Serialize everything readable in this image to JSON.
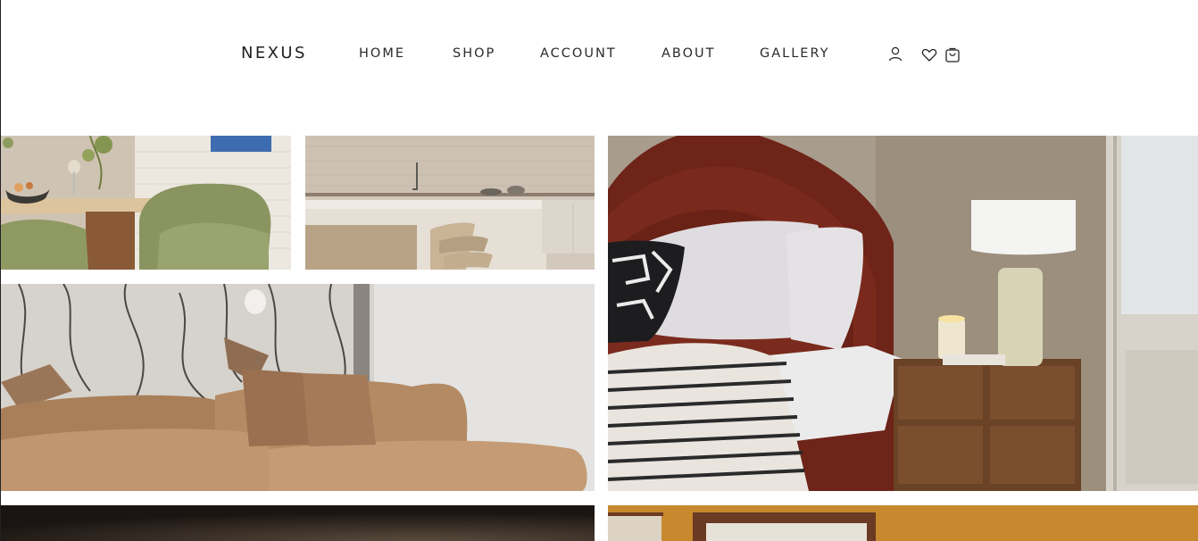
{
  "brand": {
    "name": "NEXUS"
  },
  "nav": {
    "items": [
      {
        "label": "HOME"
      },
      {
        "label": "SHOP"
      },
      {
        "label": "ACCOUNT"
      },
      {
        "label": "ABOUT"
      },
      {
        "label": "GALLERY"
      }
    ]
  },
  "header_icons": [
    "user-icon",
    "heart-icon",
    "bag-icon"
  ],
  "gallery": {
    "tiles": [
      "dining-room-photo",
      "kitchen-photo",
      "bedroom-photo",
      "living-room-sofa-photo",
      "dark-interior-photo",
      "framed-art-photo"
    ]
  },
  "colors": {
    "text": "#1f1f1f",
    "background": "#ffffff",
    "accent_rust": "#7a2a1c"
  }
}
